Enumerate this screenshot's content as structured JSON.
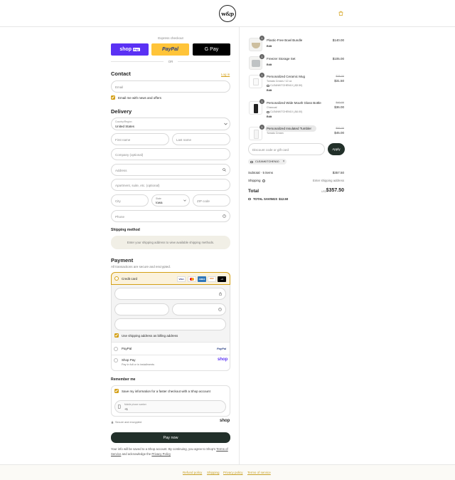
{
  "header": {
    "logo_text": "w&p",
    "cart_icon": "shopping-bag-icon"
  },
  "express": {
    "label": "Express checkout",
    "shop_pay": "shop",
    "shop_pay_badge": "Pay",
    "paypal": "PayPal",
    "gpay": "G Pay",
    "or": "OR"
  },
  "contact": {
    "title": "Contact",
    "login": "Log in",
    "email_placeholder": "Email",
    "news_label": "Email me with news and offers"
  },
  "delivery": {
    "title": "Delivery",
    "country_label": "Country/Region",
    "country_value": "United States",
    "first_name": "First name",
    "last_name": "Last name",
    "company": "Company (optional)",
    "address": "Address",
    "apartment": "Apartment, suite, etc. (optional)",
    "city": "City",
    "state_label": "State",
    "state_value": "Iowa",
    "zip": "ZIP code",
    "phone": "Phone"
  },
  "shipping": {
    "title": "Shipping method",
    "message": "Enter your shipping address to view available shipping methods."
  },
  "payment": {
    "title": "Payment",
    "subtitle": "All transactions are secure and encrypted.",
    "credit_card": "Credit card",
    "cards": [
      "VISA",
      "MC",
      "AMEX",
      "DISC",
      "+4"
    ],
    "billing_label": "Use shipping address as billing address",
    "paypal_label": "PayPal",
    "paypal_logo": "PayPal",
    "shoppay_label": "Shop Pay",
    "shoppay_sub": "Pay in full or in installments",
    "shoppay_logo": "shop"
  },
  "remember": {
    "title": "Remember me",
    "save_label": "Save my information for a faster checkout with a Shop account",
    "phone_label": "Mobile phone number",
    "phone_value": "+1",
    "secure": "Secure and encrypted",
    "shop_logo": "shop"
  },
  "pay_button": "Pay now",
  "legal": {
    "line1": "Your info will be saved to a Shop account. By continuing, you agree to Shop's",
    "terms": "Terms of Service",
    "and_text": "and acknowledge the",
    "privacy": "Privacy Policy"
  },
  "order": {
    "items": [
      {
        "name": "Plastic-Free Bowl Bundle",
        "price": "$140.00",
        "qty": "1",
        "edit": "Edit"
      },
      {
        "name": "Freezer Storage Set",
        "price": "$105.00",
        "qty": "1",
        "edit": "Edit"
      },
      {
        "name": "Personalized Ceramic Mug",
        "variant": "Tomato Cream / 12 oz",
        "discount": "CLEANKITCHEN10 (-$3.50)",
        "old_price": "$35.00",
        "price": "$31.50",
        "qty": "1",
        "edit": "Edit"
      },
      {
        "name": "Personalized Wide Mouth Glass Bottle",
        "variant": "Charcoal",
        "discount": "CLEANKITCHEN10 (-$4.00)",
        "old_price": "$40.00",
        "price": "$36.00",
        "qty": "1",
        "edit": "Edit"
      },
      {
        "name": "Personalized Insulated Tumbler",
        "variant": "Tomato Cream",
        "old_price": "$50.00",
        "price": "$45.00",
        "qty": "1"
      }
    ],
    "discount_placeholder": "Discount code or gift card",
    "apply": "Apply",
    "code_chip": "CLEANKITCHEN10",
    "subtotal_label": "Subtotal · 5 items",
    "subtotal_value": "$357.50",
    "shipping_label": "Shipping",
    "shipping_value": "Enter shipping address",
    "total_label": "Total",
    "currency": "USD",
    "total_value": "$357.50",
    "savings_label": "TOTAL SAVINGS",
    "savings_value": "$12.50"
  },
  "footer": {
    "links": [
      "Refund policy",
      "Shipping",
      "Privacy policy",
      "Terms of service"
    ]
  },
  "colors": {
    "accent": "#d4a017",
    "dark": "#22302a",
    "shop_purple": "#5a31f4",
    "paypal_yellow": "#ffc439"
  }
}
